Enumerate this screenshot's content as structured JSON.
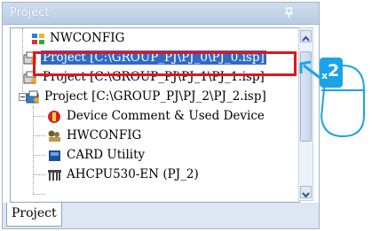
{
  "panel": {
    "title": "Project"
  },
  "tree": {
    "items": [
      {
        "label": "NWCONFIG",
        "icon": "network-config-icon"
      },
      {
        "label": "Project [C:\\GROUP_PJ\\PJ_0\\PJ_0.isp]",
        "icon": "project-icon",
        "selected": true
      },
      {
        "label": "Project [C:\\GROUP_PJ\\PJ_1\\PJ_1.isp]",
        "icon": "project-icon"
      },
      {
        "label": "Project [C:\\GROUP_PJ\\PJ_2\\PJ_2.isp]",
        "icon": "project-icon"
      },
      {
        "label": "Device Comment & Used Device",
        "icon": "device-comment-icon"
      },
      {
        "label": "HWCONFIG",
        "icon": "hwconfig-icon"
      },
      {
        "label": "CARD Utility",
        "icon": "card-utility-icon"
      },
      {
        "label": "AHCPU530-EN  (PJ_2)",
        "icon": "cpu-icon"
      }
    ]
  },
  "tabs": [
    {
      "label": "Project"
    }
  ],
  "annotation": {
    "badge": "x2",
    "color": "#1aa3e8",
    "highlight_color": "#e0151c"
  }
}
